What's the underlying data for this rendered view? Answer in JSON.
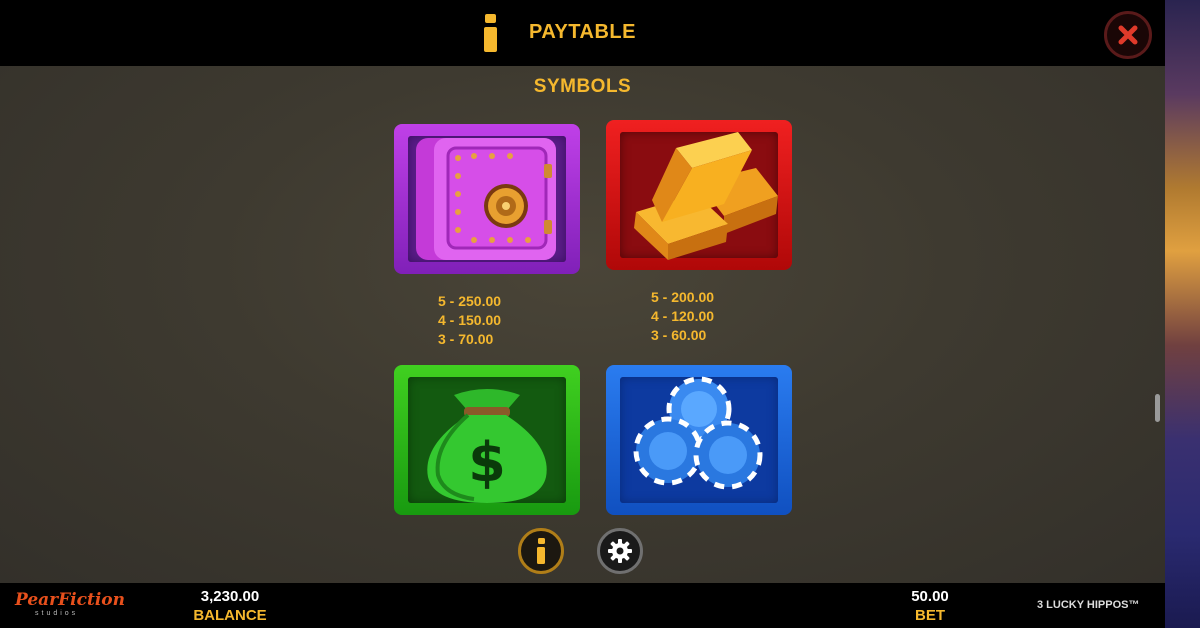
{
  "header": {
    "title": "PAYTABLE"
  },
  "content": {
    "section_title": "SYMBOLS",
    "symbols": [
      {
        "icon": "safe-icon",
        "pays": [
          "5 - 250.00",
          "4 - 150.00",
          "3 - 70.00"
        ]
      },
      {
        "icon": "gold-bars-icon",
        "pays": [
          "5 - 200.00",
          "4 - 120.00",
          "3 - 60.00"
        ]
      },
      {
        "icon": "money-bag-icon",
        "pays": []
      },
      {
        "icon": "poker-chips-icon",
        "pays": []
      }
    ]
  },
  "footer": {
    "brand": "PearFiction",
    "brand_sub": "studios",
    "balance_value": "3,230.00",
    "balance_label": "BALANCE",
    "bet_value": "50.00",
    "bet_label": "BET",
    "game_title": "3 LUCKY HIPPOS™"
  },
  "colors": {
    "accent": "#f5b82e",
    "close": "#e03a2a"
  }
}
